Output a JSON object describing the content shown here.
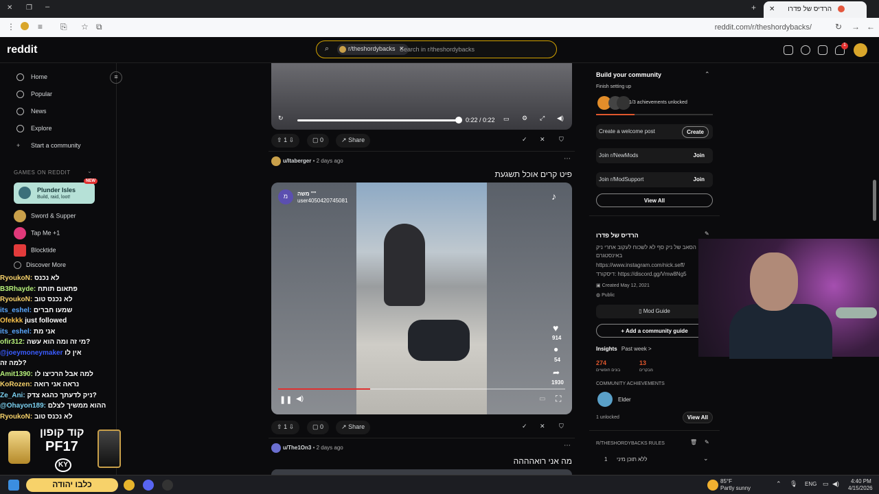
{
  "browser": {
    "tab_title": "הרדיס של פדרו",
    "url": "reddit.com/r/theshordybacks/"
  },
  "header": {
    "logo": "reddit",
    "search_chip": "r/theshordybacks",
    "search_placeholder": "Search in r/theshordybacks",
    "notif_count": "1"
  },
  "sidebar": {
    "nav": [
      {
        "label": "Home",
        "icon": "home-icon"
      },
      {
        "label": "Popular",
        "icon": "popular-icon"
      },
      {
        "label": "News",
        "icon": "news-icon"
      },
      {
        "label": "Explore",
        "icon": "explore-icon"
      },
      {
        "label": "Start a community",
        "icon": "plus-icon"
      }
    ],
    "games_heading": "GAMES ON REDDIT",
    "featured_game": {
      "title": "Plunder Isles",
      "subtitle": "Build, raid, loot!",
      "badge": "NEW"
    },
    "games": [
      {
        "label": "Sword & Supper",
        "color": "#c9a04a"
      },
      {
        "label": "Tap Me +1",
        "color": "#e0397a"
      },
      {
        "label": "Blocktide",
        "color": "#e23b3b"
      },
      {
        "label": "Discover More",
        "color": "#777"
      }
    ]
  },
  "chat": [
    {
      "user": "RyoukoN:",
      "msg": "לא נכנס",
      "color": "#f7d26a"
    },
    {
      "user": "B3Rhayde:",
      "msg": "פתאום תותח",
      "color": "#b6f07a"
    },
    {
      "user": "RyoukoN:",
      "msg": "לא נכנס טוב",
      "color": "#f7d26a"
    },
    {
      "user": "its_eshel:",
      "msg": "שמעו חברים",
      "color": "#5aa8ff"
    },
    {
      "user": "Ofekkk",
      "msg": "just followed",
      "color": "#f7c04a"
    },
    {
      "user": "its_eshel:",
      "msg": "אני מת",
      "color": "#5aa8ff"
    },
    {
      "user": "ofir312:",
      "msg": "מי זה ומה הוא עשה?",
      "color": "#b6f07a"
    },
    {
      "user": "@joeymoneymaker",
      "msg": "אין לו",
      "color": "#3a5cff"
    },
    {
      "user": "",
      "msg": "למה זה?",
      "color": "#ffffff"
    },
    {
      "user": "Amit1390:",
      "msg": "למה אבל הרכיצו לו",
      "color": "#b6f07a"
    },
    {
      "user": "KoRozen:",
      "msg": "נראה אני רואה",
      "color": "#f7d26a"
    },
    {
      "user": "Ze_Ani:",
      "msg": "ניק לדעתך כהגא צדק?",
      "color": "#7ad0f0"
    },
    {
      "user": "@Ohayon189:",
      "msg": "ההוא ממשיך לצלם",
      "color": "#7ad0f0"
    },
    {
      "user": "RyoukoN:",
      "msg": "לא נכנס טוב",
      "color": "#f7d26a"
    }
  ],
  "posts": [
    {
      "time": "0:22 / 0:22",
      "votes": "1",
      "comments": "0",
      "share": "Share"
    },
    {
      "user": "u/Itaberger",
      "age": "• 2 days ago",
      "title": "פיט קרים אוכל תשגעת",
      "votes": "1",
      "comments": "0",
      "share": "Share",
      "video": {
        "channel": "משה ''''",
        "handle": "user4050420745081",
        "likes": "914",
        "comments": "54",
        "shares": "1930",
        "progress": 0.32
      }
    },
    {
      "user": "u/The1On3",
      "age": "• 2 days ago",
      "title": "מה אני רואהההה"
    }
  ],
  "right": {
    "build_title": "Build your community",
    "finish": "Finish setting up",
    "achievements": "1/3 achievements unlocked",
    "tasks": [
      {
        "label": "Create a welcome post",
        "btn": "Create"
      },
      {
        "label": "Join r/NewMods",
        "btn": "Join"
      },
      {
        "label": "Join r/ModSupport",
        "btn": "Join"
      }
    ],
    "view_all": "View All",
    "about_title": "הרדיס של פדרו",
    "about_desc": "הסאב של ניק סף לא לשכוח לעקוב אחרי ניק באינסטגרם",
    "insta": "https://www.instagram.com/nick.seff/",
    "discord": "דיסקורד: https://discord.gg/Vmw8Ng5",
    "created": "Created May 12, 2021",
    "visibility": "Public",
    "mod_guide": "Mod Guide",
    "add_guide": "Add a community guide",
    "insights": "Insights",
    "past_week": "Past week >",
    "stat1": "274",
    "stat1_label": "בונים חופשיים",
    "stat2": "13",
    "stat2_label": "מבקרים",
    "ach_heading": "COMMUNITY ACHIEVEMENTS",
    "ach_name": "Elder",
    "unlocked": "1 unlocked",
    "ach_view": "View All",
    "rules_heading": "R/THESHORDYBACKS RULES",
    "rule1_num": "1",
    "rule1": "ללא תוכן מיני"
  },
  "overlay": {
    "brand": "קוד קופון",
    "code": "PF17",
    "logo": "KY",
    "banner": "כלבו יהודה"
  },
  "taskbar": {
    "weather": "85°F",
    "weather_desc": "Partly sunny",
    "lang": "ENG",
    "time": "4:40 PM",
    "date": "4/15/2026"
  }
}
